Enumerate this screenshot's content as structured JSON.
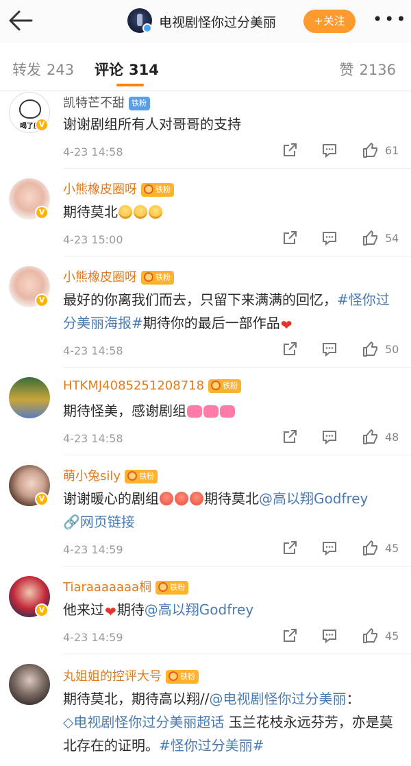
{
  "header": {
    "account_name": "电视剧怪你过分美丽",
    "follow_label": "+关注",
    "more_label": "•••"
  },
  "tabs": {
    "repost_label": "转发",
    "repost_count": "243",
    "comment_label": "评论",
    "comment_count": "314",
    "like_label": "赞",
    "like_count": "2136"
  },
  "icons": {
    "back": "arrow-left-icon",
    "share": "share-icon",
    "reply": "comment-icon",
    "like": "thumbs-up-icon"
  },
  "colors": {
    "accent": "#ff8200",
    "follow_button": "#ff9a2e",
    "username": "#e37a1a",
    "link": "#4a7bb0",
    "badge": "#ffb22c"
  },
  "comments": [
    {
      "username": "凯特芒不甜",
      "badge": "铁粉",
      "avatar_caption": "喝了般",
      "text": "谢谢剧组所有人对哥哥的支持",
      "time": "4-23 14:58",
      "likes": "61"
    },
    {
      "username": "小熊橡皮圈呀",
      "badge": "铁粉",
      "text": "期待莫北",
      "time": "4-23 15:00",
      "likes": "54"
    },
    {
      "username": "小熊橡皮圈呀",
      "badge": "铁粉",
      "text_part1": "最好的你离我们而去，只留下来满满的回忆，",
      "hashtag": "#怪你过分美丽海报#",
      "text_part2": "期待你的最后一部作品",
      "time": "4-23 14:58",
      "likes": "50"
    },
    {
      "username": "HTKMJ4085251208718",
      "badge": "铁粉",
      "text": "期待怪美，感谢剧组",
      "time": "4-23 14:58",
      "likes": "48"
    },
    {
      "username": "萌小兔sily",
      "badge": "铁粉",
      "text_part1": "谢谢暖心的剧组",
      "text_part2": "期待莫北",
      "mention": "@高以翔Godfrey",
      "web_link": "网页链接",
      "time": "4-23 14:59",
      "likes": "45"
    },
    {
      "username": "Tiaraaaaaaa桐",
      "badge": "铁粉",
      "text_part1": "他来过",
      "text_part2": "期待",
      "mention": "@高以翔Godfrey",
      "time": "4-23 14:59",
      "likes": "45"
    },
    {
      "username": "丸姐姐的控评大号",
      "badge": "铁粉",
      "text_part1": "期待莫北，期待高以翔//",
      "mention": "@电视剧怪你过分美丽",
      "text_part2": "：",
      "supertopic": "电视剧怪你过分美丽超话",
      "text_part3": " 玉兰花枝永远芬芳，亦是莫北存在的证明。",
      "hashtag": "#怪你过分美丽#"
    }
  ]
}
